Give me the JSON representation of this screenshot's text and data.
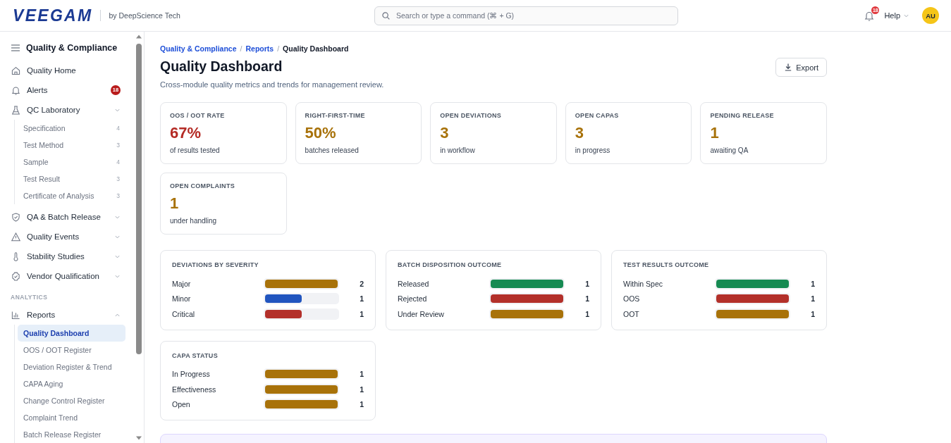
{
  "header": {
    "logo": "VEEGAM",
    "tagline": "by DeepScience Tech",
    "search": {
      "placeholder": "Search or type a command (⌘ + G)"
    },
    "notifications": {
      "badge": "18"
    },
    "help": "Help",
    "avatar": "AU"
  },
  "sidebar": {
    "title": "Quality & Compliance",
    "groups": [
      {
        "items": [
          {
            "label": "Quality Home",
            "selected": false
          },
          {
            "label": "Alerts",
            "badge": "18",
            "selected": false
          },
          {
            "label": "QC Laboratory",
            "caret_up": false,
            "selected": false,
            "children": [
              {
                "label": "Specification",
                "count": "4",
                "selected": false
              },
              {
                "label": "Test Method",
                "count": "3",
                "selected": false
              },
              {
                "label": "Sample",
                "count": "4",
                "selected": false
              },
              {
                "label": "Test Result",
                "count": "3",
                "selected": false
              },
              {
                "label": "Certificate of Analysis",
                "count": "3",
                "selected": false
              }
            ]
          },
          {
            "label": "QA & Batch Release",
            "caret_up": false,
            "selected": false
          },
          {
            "label": "Quality Events",
            "caret_up": false,
            "selected": false
          },
          {
            "label": "Stability Studies",
            "caret_up": false,
            "selected": false
          },
          {
            "label": "Vendor Qualification",
            "caret_up": false,
            "selected": false
          }
        ]
      },
      {
        "heading": "ANALYTICS",
        "items": [
          {
            "label": "Reports",
            "caret_up": true,
            "selected": false,
            "children": [
              {
                "label": "Quality Dashboard",
                "selected": true
              },
              {
                "label": "OOS / OOT Register",
                "selected": false
              },
              {
                "label": "Deviation Register & Trend",
                "selected": false
              },
              {
                "label": "CAPA Aging",
                "selected": false
              },
              {
                "label": "Change Control Register",
                "selected": false
              },
              {
                "label": "Complaint Trend",
                "selected": false
              },
              {
                "label": "Batch Release Register",
                "selected": false
              }
            ]
          }
        ]
      }
    ]
  },
  "breadcrumb": [
    {
      "kind": "link",
      "label": "Quality & Compliance"
    },
    {
      "kind": "separator",
      "label": "/"
    },
    {
      "kind": "link",
      "label": "Reports"
    },
    {
      "kind": "separator",
      "label": "/"
    },
    {
      "kind": "current",
      "label": "Quality Dashboard"
    }
  ],
  "page": {
    "title": "Quality Dashboard",
    "subtitle": "Cross-module quality metrics and trends for management review.",
    "export_button": "Export"
  },
  "kpis": [
    {
      "label": "OOS / OOT RATE",
      "value": "67%",
      "note": "of results tested",
      "color": "#b42b25"
    },
    {
      "label": "RIGHT-FIRST-TIME",
      "value": "50%",
      "note": "batches released",
      "color": "#a8720a"
    },
    {
      "label": "OPEN DEVIATIONS",
      "value": "3",
      "note": "in workflow",
      "color": "#a8720a"
    },
    {
      "label": "OPEN CAPAS",
      "value": "3",
      "note": "in progress",
      "color": "#a8720a"
    },
    {
      "label": "PENDING RELEASE",
      "value": "1",
      "note": "awaiting QA",
      "color": "#a8720a"
    },
    {
      "label": "OPEN COMPLAINTS",
      "value": "1",
      "note": "under handling",
      "color": "#a8720a"
    }
  ],
  "panels": [
    {
      "title": "DEVIATIONS BY SEVERITY",
      "rows": [
        {
          "label": "Major",
          "level": 1,
          "count": "2",
          "color": "#a8720a"
        },
        {
          "label": "Minor",
          "level": 0.5,
          "count": "1",
          "color": "#2155bf"
        },
        {
          "label": "Critical",
          "level": 0.5,
          "count": "1",
          "color": "#b3302a"
        }
      ]
    },
    {
      "title": "BATCH DISPOSITION OUTCOME",
      "rows": [
        {
          "label": "Released",
          "level": 1,
          "count": "1",
          "color": "#168a52"
        },
        {
          "label": "Rejected",
          "level": 1,
          "count": "1",
          "color": "#b3302a"
        },
        {
          "label": "Under Review",
          "level": 1,
          "count": "1",
          "color": "#a8720a"
        }
      ]
    },
    {
      "title": "TEST RESULTS OUTCOME",
      "rows": [
        {
          "label": "Within Spec",
          "level": 1,
          "count": "1",
          "color": "#168a52"
        },
        {
          "label": "OOS",
          "level": 1,
          "count": "1",
          "color": "#b3302a"
        },
        {
          "label": "OOT",
          "level": 1,
          "count": "1",
          "color": "#a8720a"
        }
      ]
    },
    {
      "title": "CAPA STATUS",
      "rows": [
        {
          "label": "In Progress",
          "level": 1,
          "count": "1",
          "color": "#a8720a"
        },
        {
          "label": "Effectiveness",
          "level": 1,
          "count": "1",
          "color": "#a8720a"
        },
        {
          "label": "Open",
          "level": 1,
          "count": "1",
          "color": "#a8720a"
        }
      ]
    }
  ]
}
